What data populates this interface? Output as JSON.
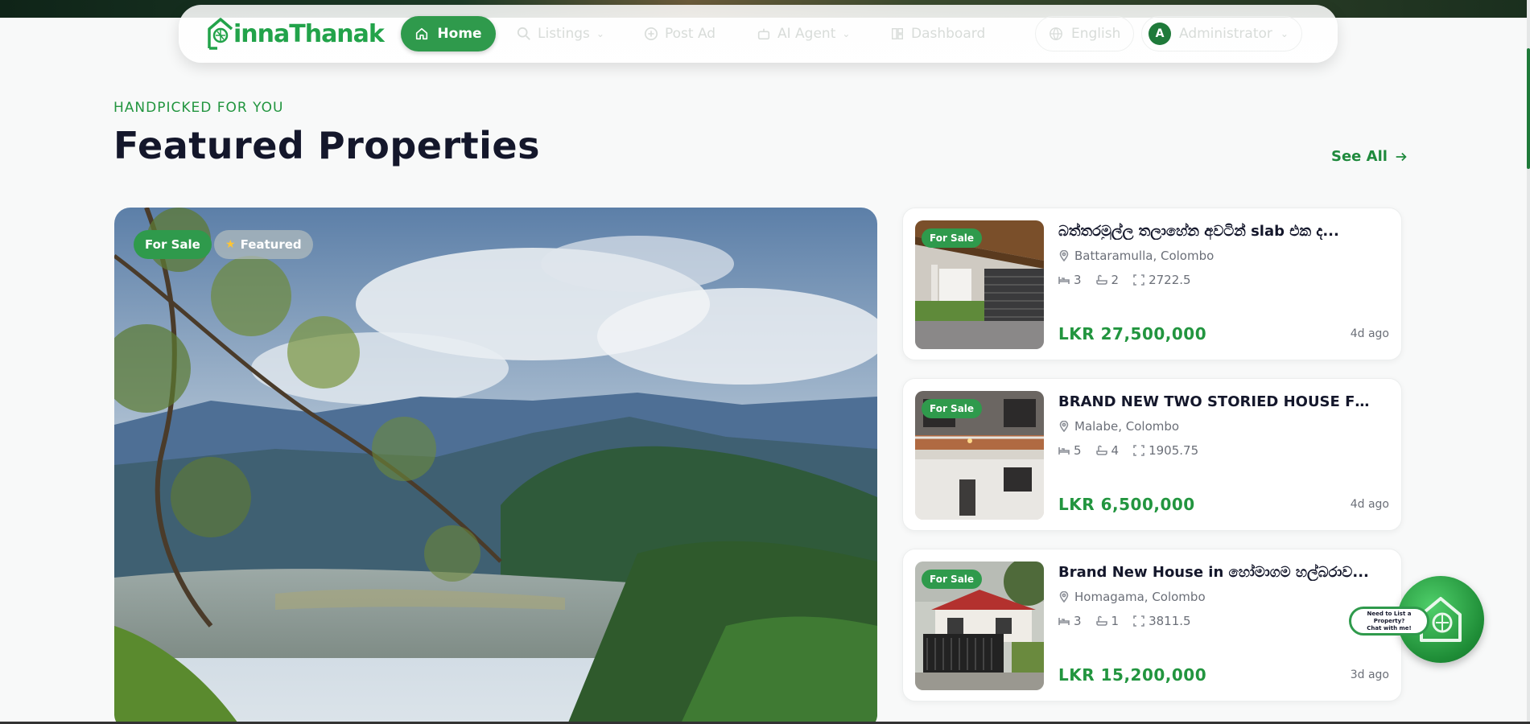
{
  "nav": {
    "logo_text": "innaThanak",
    "items": [
      {
        "label": "Home",
        "icon": "home-icon"
      },
      {
        "label": "Listings",
        "icon": "search-icon"
      },
      {
        "label": "Post Ad",
        "icon": "plus-circle-icon"
      },
      {
        "label": "AI Agent",
        "icon": "bot-icon"
      },
      {
        "label": "Dashboard",
        "icon": "dashboard-icon"
      }
    ],
    "language": "English",
    "user_initial": "A",
    "user_name": "Administrator"
  },
  "section": {
    "eyebrow": "HANDPICKED FOR YOU",
    "title": "Featured Properties",
    "see_all": "See All"
  },
  "hero": {
    "badge_sale": "For Sale",
    "badge_featured": "Featured"
  },
  "listings": [
    {
      "badge": "For Sale",
      "title": "බත්තරමුල්ල තලාහේන අවටින් slab එක ද...",
      "location": "Battaramulla, Colombo",
      "beds": "3",
      "baths": "2",
      "area": "2722.5",
      "price": "LKR 27,500,000",
      "posted": "4d ago"
    },
    {
      "badge": "For Sale",
      "title": "BRAND NEW TWO STORIED HOUSE FOR...",
      "location": "Malabe, Colombo",
      "beds": "5",
      "baths": "4",
      "area": "1905.75",
      "price": "LKR 6,500,000",
      "posted": "4d ago"
    },
    {
      "badge": "For Sale",
      "title": "Brand New House in හෝමාගම හල්බරාව...",
      "location": "Homagama, Colombo",
      "beds": "3",
      "baths": "1",
      "area": "3811.5",
      "price": "LKR 15,200,000",
      "posted": "3d ago"
    }
  ],
  "chat": {
    "line1": "Need to List a Property?",
    "line2": "Chat with me!"
  },
  "colors": {
    "brand_green": "#2f9a4c",
    "price_green": "#22953f",
    "title_dark": "#14172b"
  }
}
